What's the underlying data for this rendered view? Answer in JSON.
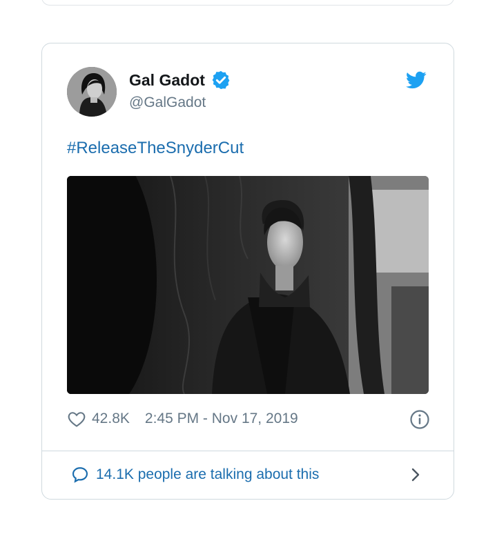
{
  "tweet": {
    "author_name": "Gal Gadot",
    "author_handle": "@GalGadot",
    "hashtag": "#ReleaseTheSnyderCut",
    "likes": "42.8K",
    "timestamp": "2:45 PM - Nov 17, 2019",
    "talking": "14.1K people are talking about this"
  },
  "icons": {
    "verified": "verified-badge-icon",
    "bird": "twitter-bird-icon",
    "heart": "heart-icon",
    "info": "info-icon",
    "bubble": "reply-bubble-icon",
    "chevron": "chevron-right-icon"
  },
  "colors": {
    "accent": "#1da1f2",
    "link": "#1b6dae",
    "muted": "#657786",
    "border": "#cfd9de"
  }
}
